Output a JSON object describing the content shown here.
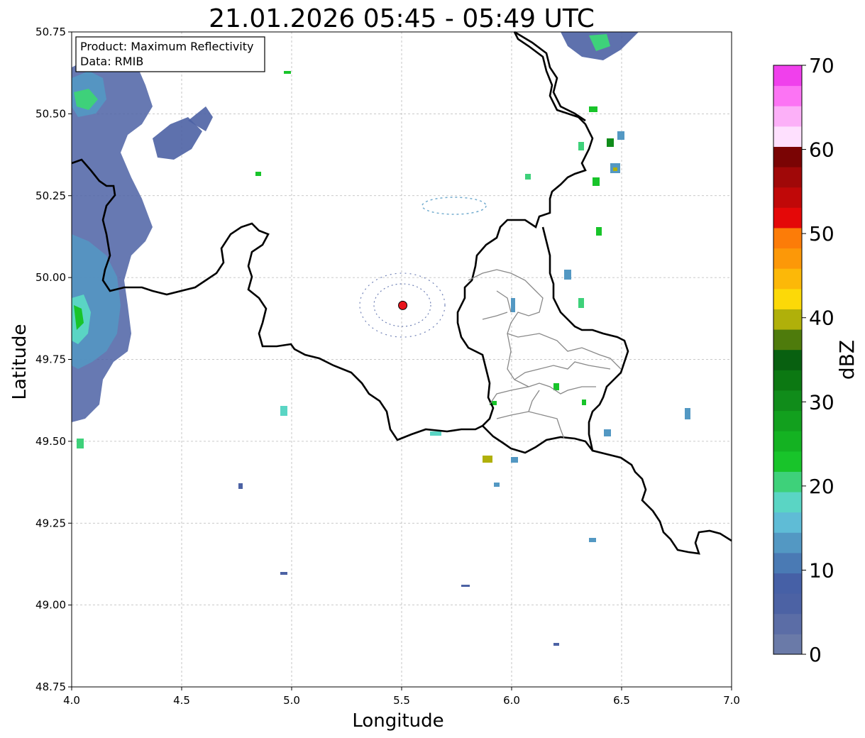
{
  "title": "21.01.2026 05:45 - 05:49 UTC",
  "info_box": {
    "product_line": "Product: Maximum Reflectivity",
    "data_line": "Data: RMIB"
  },
  "chart_data": {
    "type": "map",
    "xlabel": "Longitude",
    "ylabel": "Latitude",
    "xlim": [
      4.0,
      7.0
    ],
    "ylim": [
      48.75,
      50.75
    ],
    "x_ticks": [
      "4.0",
      "4.5",
      "5.0",
      "5.5",
      "6.0",
      "6.5",
      "7.0"
    ],
    "y_ticks": [
      "48.75",
      "49.00",
      "49.25",
      "49.50",
      "49.75",
      "50.00",
      "50.25",
      "50.50",
      "50.75"
    ],
    "grid": true,
    "radar_site": {
      "lon": 5.505,
      "lat": 49.915,
      "color": "#e8141c"
    },
    "colorbar": {
      "label": "dBZ",
      "range": [
        0,
        70
      ],
      "ticks": [
        "0",
        "10",
        "20",
        "30",
        "40",
        "50",
        "60",
        "70"
      ],
      "colors": [
        "#6a7aa8",
        "#5b6da6",
        "#4c62a4",
        "#4660a6",
        "#4a7ab4",
        "#5398c3",
        "#5fbcd6",
        "#5ad5c4",
        "#3ed17a",
        "#18c42a",
        "#14b222",
        "#12a01e",
        "#108c1a",
        "#0c7812",
        "#086010",
        "#4e7b0c",
        "#b0b00a",
        "#fcd908",
        "#fcb808",
        "#fc9808",
        "#fc7c08",
        "#e40808",
        "#c00808",
        "#a00808",
        "#7a0404",
        "#fee0fe",
        "#fcb0f8",
        "#fc74f4",
        "#f040ec"
      ]
    },
    "echoes": [
      {
        "lon": 4.05,
        "lat": 49.88,
        "dbz": 20
      },
      {
        "lon": 4.07,
        "lat": 50.52,
        "dbz": 22
      },
      {
        "lon": 4.02,
        "lat": 50.38,
        "dbz": 8
      },
      {
        "lon": 4.05,
        "lat": 49.62,
        "dbz": 6
      },
      {
        "lon": 4.15,
        "lat": 50.1,
        "dbz": 7
      },
      {
        "lon": 4.2,
        "lat": 50.45,
        "dbz": 8
      },
      {
        "lon": 4.45,
        "lat": 50.4,
        "dbz": 9
      },
      {
        "lon": 4.55,
        "lat": 50.42,
        "dbz": 8
      },
      {
        "lon": 6.4,
        "lat": 50.7,
        "dbz": 14
      },
      {
        "lon": 6.45,
        "lat": 50.65,
        "dbz": 20
      },
      {
        "lon": 6.35,
        "lat": 50.33,
        "dbz": 38
      },
      {
        "lon": 6.38,
        "lat": 50.3,
        "dbz": 24
      },
      {
        "lon": 6.37,
        "lat": 50.41,
        "dbz": 20
      },
      {
        "lon": 6.3,
        "lat": 50.5,
        "dbz": 20
      },
      {
        "lon": 5.89,
        "lat": 49.44,
        "dbz": 38
      },
      {
        "lon": 6.83,
        "lat": 49.59,
        "dbz": 12
      },
      {
        "lon": 6.26,
        "lat": 49.22,
        "dbz": 12
      },
      {
        "lon": 4.1,
        "lat": 49.52,
        "dbz": 20
      }
    ]
  }
}
